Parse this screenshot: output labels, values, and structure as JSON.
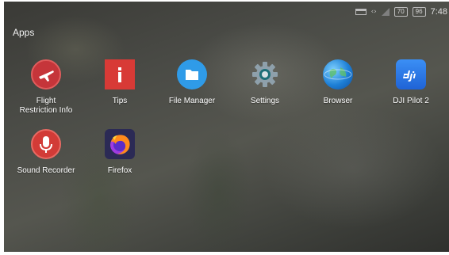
{
  "status_bar": {
    "battery_badge_1": "70",
    "battery_badge_2": "96",
    "time": "7:48",
    "icons": [
      "dock-icon",
      "data-arrows-icon",
      "signal-icon",
      "battery-icon"
    ]
  },
  "section_title": "Apps",
  "apps": [
    {
      "label": "Flight\nRestriction Info",
      "icon": "airplane-icon"
    },
    {
      "label": "Tips",
      "icon": "info-icon"
    },
    {
      "label": "File Manager",
      "icon": "folder-icon"
    },
    {
      "label": "Settings",
      "icon": "gear-icon"
    },
    {
      "label": "Browser",
      "icon": "globe-icon"
    },
    {
      "label": "DJI Pilot 2",
      "icon": "dji-logo-icon"
    },
    {
      "label": "Sound Recorder",
      "icon": "microphone-icon"
    },
    {
      "label": "Firefox",
      "icon": "firefox-icon"
    }
  ]
}
